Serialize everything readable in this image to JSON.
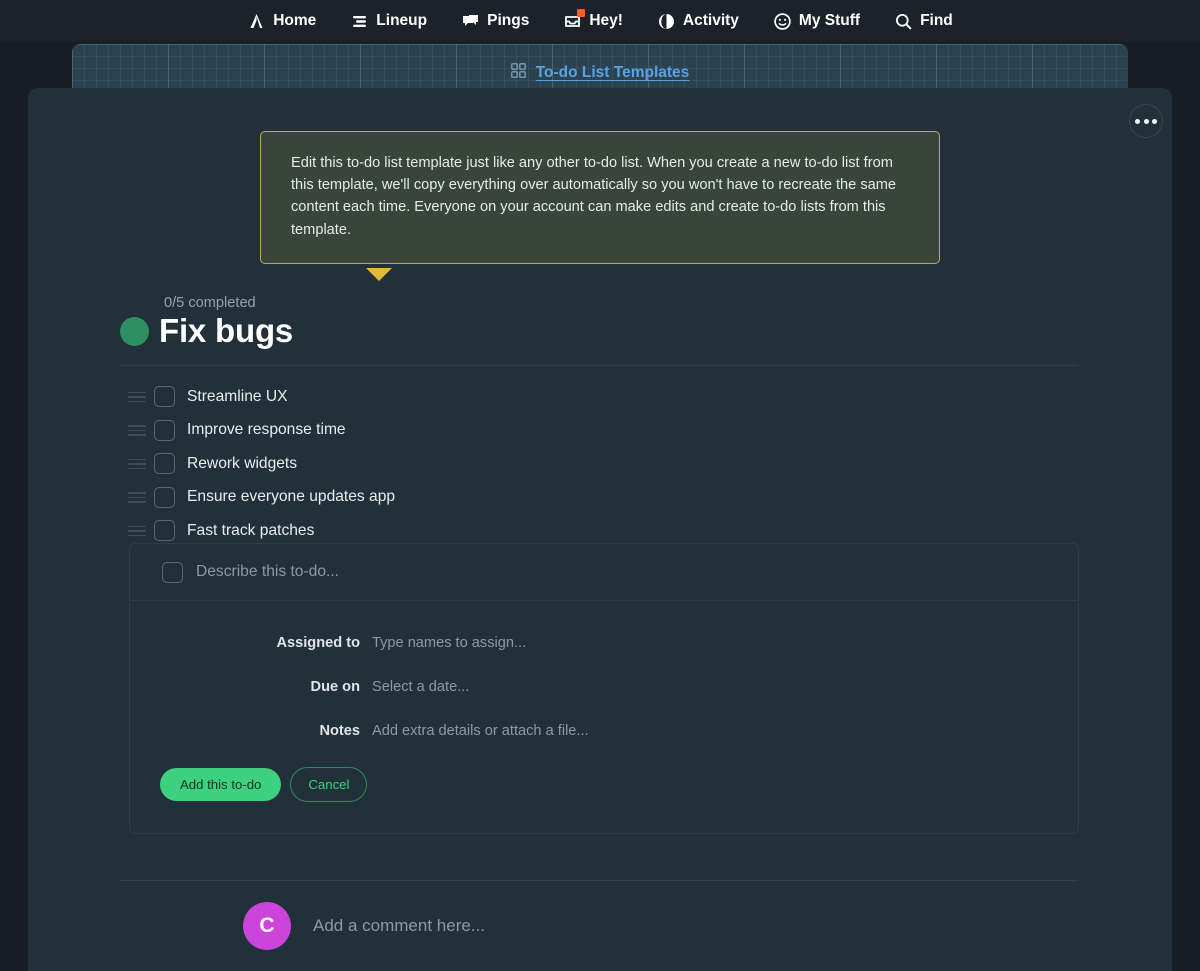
{
  "topnav": {
    "items": [
      {
        "label": "Home",
        "icon": "tent-icon",
        "badge": false
      },
      {
        "label": "Lineup",
        "icon": "lineup-icon",
        "badge": false
      },
      {
        "label": "Pings",
        "icon": "chat-icon",
        "badge": false
      },
      {
        "label": "Hey!",
        "icon": "inbox-icon",
        "badge": true
      },
      {
        "label": "Activity",
        "icon": "moon-icon",
        "badge": false
      },
      {
        "label": "My Stuff",
        "icon": "smiley-icon",
        "badge": false
      },
      {
        "label": "Find",
        "icon": "search-icon",
        "badge": false
      }
    ]
  },
  "breadcrumb": {
    "icon": "grid-icon",
    "link_label": "To-do List Templates"
  },
  "card": {
    "more_label": "More options",
    "more_icon": "ellipsis-icon"
  },
  "callout": {
    "text": "Edit this to-do list template just like any other to-do list. When you create a new to-do list from this template, we'll copy everything over automatically so you won't have to recreate the same content each time. Everyone on your account can make edits and create to-do lists from this template."
  },
  "list": {
    "completed_text": "0/5 completed",
    "completed_count": 0,
    "total_count": 5,
    "title": "Fix bugs",
    "status_color": "#2e9062",
    "items": [
      {
        "label": "Streamline UX",
        "checked": false
      },
      {
        "label": "Improve response time",
        "checked": false
      },
      {
        "label": "Rework widgets",
        "checked": false
      },
      {
        "label": "Ensure everyone updates app",
        "checked": false
      },
      {
        "label": "Fast track patches",
        "checked": false
      }
    ]
  },
  "new_todo_form": {
    "describe_placeholder": "Describe this to-do...",
    "fields": [
      {
        "label": "Assigned to",
        "placeholder": "Type names to assign..."
      },
      {
        "label": "Due on",
        "placeholder": "Select a date..."
      },
      {
        "label": "Notes",
        "placeholder": "Add extra details or attach a file..."
      }
    ],
    "submit_label": "Add this to-do",
    "cancel_label": "Cancel"
  },
  "comment": {
    "avatar_initial": "C",
    "avatar_color": "#cc44d9",
    "placeholder": "Add a comment here..."
  },
  "colors": {
    "page_bg": "#161d24",
    "topnav_bg": "#1b2229",
    "card_bg": "#223039",
    "crumb_bg": "#2b4251",
    "crumb_link": "#5ba2e0",
    "callout_bg": "#39443b",
    "callout_border": "#bfa84f",
    "callout_arrow": "#e2b93b",
    "accent_green": "#3dd07f",
    "badge_orange": "#ff5d1c"
  }
}
